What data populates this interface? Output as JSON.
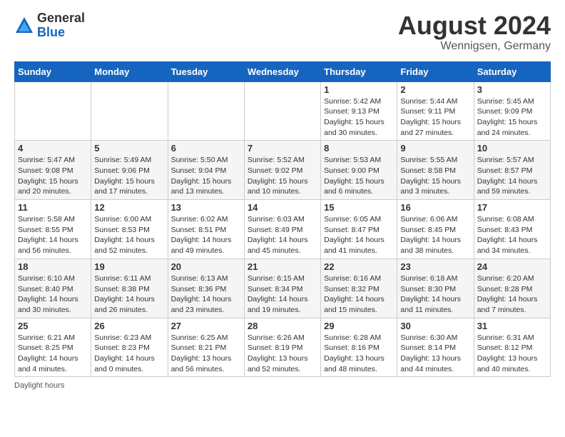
{
  "header": {
    "logo_general": "General",
    "logo_blue": "Blue",
    "month_year": "August 2024",
    "location": "Wennigsen, Germany"
  },
  "legend": {
    "daylight_label": "Daylight hours"
  },
  "days_of_week": [
    "Sunday",
    "Monday",
    "Tuesday",
    "Wednesday",
    "Thursday",
    "Friday",
    "Saturday"
  ],
  "weeks": [
    [
      {
        "day": "",
        "sunrise": "",
        "sunset": "",
        "daylight": "",
        "empty": true
      },
      {
        "day": "",
        "sunrise": "",
        "sunset": "",
        "daylight": "",
        "empty": true
      },
      {
        "day": "",
        "sunrise": "",
        "sunset": "",
        "daylight": "",
        "empty": true
      },
      {
        "day": "",
        "sunrise": "",
        "sunset": "",
        "daylight": "",
        "empty": true
      },
      {
        "day": "1",
        "sunrise": "Sunrise: 5:42 AM",
        "sunset": "Sunset: 9:13 PM",
        "daylight": "Daylight: 15 hours and 30 minutes."
      },
      {
        "day": "2",
        "sunrise": "Sunrise: 5:44 AM",
        "sunset": "Sunset: 9:11 PM",
        "daylight": "Daylight: 15 hours and 27 minutes."
      },
      {
        "day": "3",
        "sunrise": "Sunrise: 5:45 AM",
        "sunset": "Sunset: 9:09 PM",
        "daylight": "Daylight: 15 hours and 24 minutes."
      }
    ],
    [
      {
        "day": "4",
        "sunrise": "Sunrise: 5:47 AM",
        "sunset": "Sunset: 9:08 PM",
        "daylight": "Daylight: 15 hours and 20 minutes."
      },
      {
        "day": "5",
        "sunrise": "Sunrise: 5:49 AM",
        "sunset": "Sunset: 9:06 PM",
        "daylight": "Daylight: 15 hours and 17 minutes."
      },
      {
        "day": "6",
        "sunrise": "Sunrise: 5:50 AM",
        "sunset": "Sunset: 9:04 PM",
        "daylight": "Daylight: 15 hours and 13 minutes."
      },
      {
        "day": "7",
        "sunrise": "Sunrise: 5:52 AM",
        "sunset": "Sunset: 9:02 PM",
        "daylight": "Daylight: 15 hours and 10 minutes."
      },
      {
        "day": "8",
        "sunrise": "Sunrise: 5:53 AM",
        "sunset": "Sunset: 9:00 PM",
        "daylight": "Daylight: 15 hours and 6 minutes."
      },
      {
        "day": "9",
        "sunrise": "Sunrise: 5:55 AM",
        "sunset": "Sunset: 8:58 PM",
        "daylight": "Daylight: 15 hours and 3 minutes."
      },
      {
        "day": "10",
        "sunrise": "Sunrise: 5:57 AM",
        "sunset": "Sunset: 8:57 PM",
        "daylight": "Daylight: 14 hours and 59 minutes."
      }
    ],
    [
      {
        "day": "11",
        "sunrise": "Sunrise: 5:58 AM",
        "sunset": "Sunset: 8:55 PM",
        "daylight": "Daylight: 14 hours and 56 minutes."
      },
      {
        "day": "12",
        "sunrise": "Sunrise: 6:00 AM",
        "sunset": "Sunset: 8:53 PM",
        "daylight": "Daylight: 14 hours and 52 minutes."
      },
      {
        "day": "13",
        "sunrise": "Sunrise: 6:02 AM",
        "sunset": "Sunset: 8:51 PM",
        "daylight": "Daylight: 14 hours and 49 minutes."
      },
      {
        "day": "14",
        "sunrise": "Sunrise: 6:03 AM",
        "sunset": "Sunset: 8:49 PM",
        "daylight": "Daylight: 14 hours and 45 minutes."
      },
      {
        "day": "15",
        "sunrise": "Sunrise: 6:05 AM",
        "sunset": "Sunset: 8:47 PM",
        "daylight": "Daylight: 14 hours and 41 minutes."
      },
      {
        "day": "16",
        "sunrise": "Sunrise: 6:06 AM",
        "sunset": "Sunset: 8:45 PM",
        "daylight": "Daylight: 14 hours and 38 minutes."
      },
      {
        "day": "17",
        "sunrise": "Sunrise: 6:08 AM",
        "sunset": "Sunset: 8:43 PM",
        "daylight": "Daylight: 14 hours and 34 minutes."
      }
    ],
    [
      {
        "day": "18",
        "sunrise": "Sunrise: 6:10 AM",
        "sunset": "Sunset: 8:40 PM",
        "daylight": "Daylight: 14 hours and 30 minutes."
      },
      {
        "day": "19",
        "sunrise": "Sunrise: 6:11 AM",
        "sunset": "Sunset: 8:38 PM",
        "daylight": "Daylight: 14 hours and 26 minutes."
      },
      {
        "day": "20",
        "sunrise": "Sunrise: 6:13 AM",
        "sunset": "Sunset: 8:36 PM",
        "daylight": "Daylight: 14 hours and 23 minutes."
      },
      {
        "day": "21",
        "sunrise": "Sunrise: 6:15 AM",
        "sunset": "Sunset: 8:34 PM",
        "daylight": "Daylight: 14 hours and 19 minutes."
      },
      {
        "day": "22",
        "sunrise": "Sunrise: 6:16 AM",
        "sunset": "Sunset: 8:32 PM",
        "daylight": "Daylight: 14 hours and 15 minutes."
      },
      {
        "day": "23",
        "sunrise": "Sunrise: 6:18 AM",
        "sunset": "Sunset: 8:30 PM",
        "daylight": "Daylight: 14 hours and 11 minutes."
      },
      {
        "day": "24",
        "sunrise": "Sunrise: 6:20 AM",
        "sunset": "Sunset: 8:28 PM",
        "daylight": "Daylight: 14 hours and 7 minutes."
      }
    ],
    [
      {
        "day": "25",
        "sunrise": "Sunrise: 6:21 AM",
        "sunset": "Sunset: 8:25 PM",
        "daylight": "Daylight: 14 hours and 4 minutes."
      },
      {
        "day": "26",
        "sunrise": "Sunrise: 6:23 AM",
        "sunset": "Sunset: 8:23 PM",
        "daylight": "Daylight: 14 hours and 0 minutes."
      },
      {
        "day": "27",
        "sunrise": "Sunrise: 6:25 AM",
        "sunset": "Sunset: 8:21 PM",
        "daylight": "Daylight: 13 hours and 56 minutes."
      },
      {
        "day": "28",
        "sunrise": "Sunrise: 6:26 AM",
        "sunset": "Sunset: 8:19 PM",
        "daylight": "Daylight: 13 hours and 52 minutes."
      },
      {
        "day": "29",
        "sunrise": "Sunrise: 6:28 AM",
        "sunset": "Sunset: 8:16 PM",
        "daylight": "Daylight: 13 hours and 48 minutes."
      },
      {
        "day": "30",
        "sunrise": "Sunrise: 6:30 AM",
        "sunset": "Sunset: 8:14 PM",
        "daylight": "Daylight: 13 hours and 44 minutes."
      },
      {
        "day": "31",
        "sunrise": "Sunrise: 6:31 AM",
        "sunset": "Sunset: 8:12 PM",
        "daylight": "Daylight: 13 hours and 40 minutes."
      }
    ]
  ]
}
